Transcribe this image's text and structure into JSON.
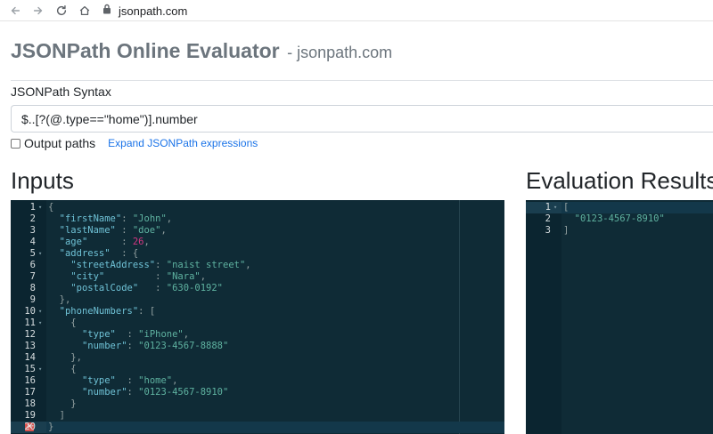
{
  "browser": {
    "url": "jsonpath.com",
    "icons": [
      "back-arrow-icon",
      "forward-arrow-icon",
      "reload-icon",
      "home-icon",
      "lock-icon"
    ]
  },
  "header": {
    "title": "JSONPath Online Evaluator",
    "subtitle": "- jsonpath.com"
  },
  "syntax": {
    "label": "JSONPath Syntax",
    "value": "$..[?(@.type==\"home\")].number"
  },
  "options": {
    "output_paths_label": "Output paths",
    "output_paths_checked": false,
    "expand_link": "Expand JSONPath expressions"
  },
  "inputs": {
    "heading": "Inputs",
    "lines": [
      {
        "n": "1",
        "fold": true,
        "tokens": [
          {
            "t": "p",
            "v": "{"
          }
        ]
      },
      {
        "n": "2",
        "tokens": [
          {
            "t": "p",
            "v": "  "
          },
          {
            "t": "k",
            "v": "\"firstName\""
          },
          {
            "t": "p",
            "v": ": "
          },
          {
            "t": "s",
            "v": "\"John\""
          },
          {
            "t": "p",
            "v": ","
          }
        ]
      },
      {
        "n": "3",
        "tokens": [
          {
            "t": "p",
            "v": "  "
          },
          {
            "t": "k",
            "v": "\"lastName\""
          },
          {
            "t": "p",
            "v": " : "
          },
          {
            "t": "s",
            "v": "\"doe\""
          },
          {
            "t": "p",
            "v": ","
          }
        ]
      },
      {
        "n": "4",
        "tokens": [
          {
            "t": "p",
            "v": "  "
          },
          {
            "t": "k",
            "v": "\"age\""
          },
          {
            "t": "p",
            "v": "      : "
          },
          {
            "t": "n",
            "v": "26"
          },
          {
            "t": "p",
            "v": ","
          }
        ]
      },
      {
        "n": "5",
        "fold": true,
        "tokens": [
          {
            "t": "p",
            "v": "  "
          },
          {
            "t": "k",
            "v": "\"address\""
          },
          {
            "t": "p",
            "v": "  : {"
          }
        ]
      },
      {
        "n": "6",
        "tokens": [
          {
            "t": "p",
            "v": "    "
          },
          {
            "t": "k",
            "v": "\"streetAddress\""
          },
          {
            "t": "p",
            "v": ": "
          },
          {
            "t": "s",
            "v": "\"naist street\""
          },
          {
            "t": "p",
            "v": ","
          }
        ]
      },
      {
        "n": "7",
        "tokens": [
          {
            "t": "p",
            "v": "    "
          },
          {
            "t": "k",
            "v": "\"city\""
          },
          {
            "t": "p",
            "v": "         : "
          },
          {
            "t": "s",
            "v": "\"Nara\""
          },
          {
            "t": "p",
            "v": ","
          }
        ]
      },
      {
        "n": "8",
        "tokens": [
          {
            "t": "p",
            "v": "    "
          },
          {
            "t": "k",
            "v": "\"postalCode\""
          },
          {
            "t": "p",
            "v": "   : "
          },
          {
            "t": "s",
            "v": "\"630-0192\""
          }
        ]
      },
      {
        "n": "9",
        "tokens": [
          {
            "t": "p",
            "v": "  },"
          }
        ]
      },
      {
        "n": "10",
        "fold": true,
        "tokens": [
          {
            "t": "p",
            "v": "  "
          },
          {
            "t": "k",
            "v": "\"phoneNumbers\""
          },
          {
            "t": "p",
            "v": ": ["
          }
        ]
      },
      {
        "n": "11",
        "fold": true,
        "tokens": [
          {
            "t": "p",
            "v": "    {"
          }
        ]
      },
      {
        "n": "12",
        "tokens": [
          {
            "t": "p",
            "v": "      "
          },
          {
            "t": "k",
            "v": "\"type\""
          },
          {
            "t": "p",
            "v": "  : "
          },
          {
            "t": "s",
            "v": "\"iPhone\""
          },
          {
            "t": "p",
            "v": ","
          }
        ]
      },
      {
        "n": "13",
        "tokens": [
          {
            "t": "p",
            "v": "      "
          },
          {
            "t": "k",
            "v": "\"number\""
          },
          {
            "t": "p",
            "v": ": "
          },
          {
            "t": "s",
            "v": "\"0123-4567-8888\""
          }
        ]
      },
      {
        "n": "14",
        "tokens": [
          {
            "t": "p",
            "v": "    },"
          }
        ]
      },
      {
        "n": "15",
        "fold": true,
        "tokens": [
          {
            "t": "p",
            "v": "    {"
          }
        ]
      },
      {
        "n": "16",
        "tokens": [
          {
            "t": "p",
            "v": "      "
          },
          {
            "t": "k",
            "v": "\"type\""
          },
          {
            "t": "p",
            "v": "  : "
          },
          {
            "t": "s",
            "v": "\"home\""
          },
          {
            "t": "p",
            "v": ","
          }
        ]
      },
      {
        "n": "17",
        "tokens": [
          {
            "t": "p",
            "v": "      "
          },
          {
            "t": "k",
            "v": "\"number\""
          },
          {
            "t": "p",
            "v": ": "
          },
          {
            "t": "s",
            "v": "\"0123-4567-8910\""
          }
        ]
      },
      {
        "n": "18",
        "tokens": [
          {
            "t": "p",
            "v": "    }"
          }
        ]
      },
      {
        "n": "19",
        "tokens": [
          {
            "t": "p",
            "v": "  ]"
          }
        ]
      },
      {
        "n": "20",
        "error": true,
        "active": true,
        "tokens": [
          {
            "t": "p",
            "v": "}"
          }
        ]
      }
    ]
  },
  "results": {
    "heading": "Evaluation Results",
    "lines": [
      {
        "n": "1",
        "fold": true,
        "active": true,
        "tokens": [
          {
            "t": "p",
            "v": "["
          }
        ]
      },
      {
        "n": "2",
        "tokens": [
          {
            "t": "p",
            "v": "  "
          },
          {
            "t": "s",
            "v": "\"0123-4567-8910\""
          }
        ]
      },
      {
        "n": "3",
        "tokens": [
          {
            "t": "p",
            "v": "]"
          }
        ]
      }
    ]
  },
  "colors": {
    "editor_bg": "#0f2b36",
    "gutter_bg": "#0b2530",
    "key": "#6fc2d6",
    "string": "#5fb3a1",
    "number": "#d33682",
    "link": "#1a73e8",
    "error": "#d9534f"
  }
}
